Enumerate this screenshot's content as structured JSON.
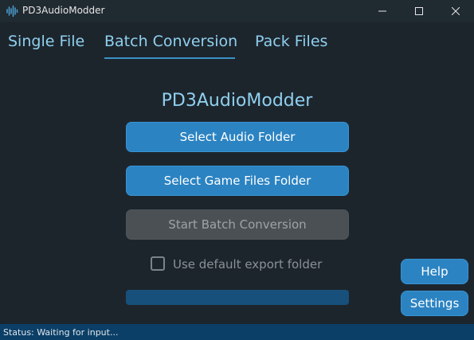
{
  "window": {
    "title": "PD3AudioModder",
    "app_icon": "waveform-icon",
    "controls": {
      "minimize_icon": "minimize-icon",
      "maximize_icon": "maximize-icon",
      "close_icon": "close-icon"
    }
  },
  "tabs": [
    {
      "label": "Single File",
      "active": false
    },
    {
      "label": "Batch Conversion",
      "active": true
    },
    {
      "label": "Pack Files",
      "active": false
    }
  ],
  "main": {
    "heading": "PD3AudioModder",
    "select_audio_label": "Select Audio Folder",
    "select_game_label": "Select Game Files Folder",
    "start_label": "Start Batch Conversion",
    "start_enabled": false,
    "default_export_label": "Use default export folder",
    "default_export_checked": false,
    "progress": 0
  },
  "side": {
    "help_label": "Help",
    "settings_label": "Settings"
  },
  "status": {
    "text": "Status: Waiting for input..."
  },
  "colors": {
    "background": "#1d252c",
    "accent": "#2b83c2",
    "tab_text": "#8fd0f0",
    "status_bar": "#0b3f67",
    "disabled": "#4a5054"
  }
}
